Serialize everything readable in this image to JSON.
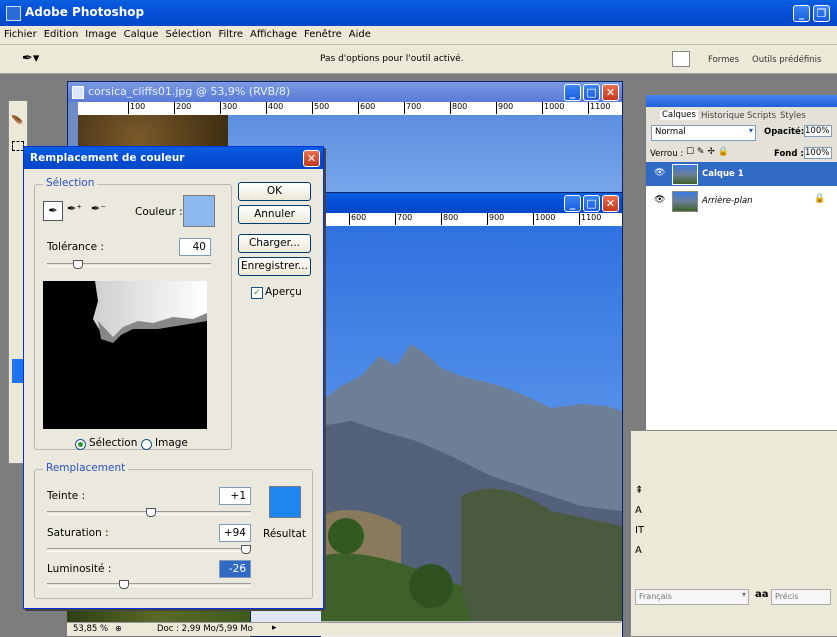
{
  "app_title": "Adobe Photoshop",
  "menu": [
    "Fichier",
    "Edition",
    "Image",
    "Calque",
    "Sélection",
    "Filtre",
    "Affichage",
    "Fenêtre",
    "Aide"
  ],
  "options_bar": {
    "message": "Pas d'options pour l'outil activé.",
    "tabs": [
      "Formes",
      "Outils prédéfinis"
    ]
  },
  "doc1": {
    "title": "corsica_cliffs01.jpg @ 53,9% (RVB/8)",
    "ruler": [
      "100",
      "200",
      "300",
      "400",
      "500",
      "600",
      "700",
      "800",
      "900",
      "1000",
      "1100"
    ]
  },
  "doc2": {
    "ruler": [
      "600",
      "700",
      "800",
      "900",
      "1000",
      "1100"
    ]
  },
  "status": {
    "zoom": "53,85 %",
    "doc": "Doc : 2,99 Mo/5,99 Mo"
  },
  "dialog": {
    "title": "Remplacement de couleur",
    "selection_group": "Sélection",
    "couleur_label": "Couleur :",
    "couleur_swatch": "#8bb9ee",
    "tolerance_label": "Tolérance :",
    "tolerance_value": "40",
    "radio_selection": "Sélection",
    "radio_image": "Image",
    "replacement_group": "Remplacement",
    "teinte_label": "Teinte :",
    "teinte_value": "+1",
    "saturation_label": "Saturation :",
    "saturation_value": "+94",
    "luminosite_label": "Luminosité :",
    "luminosite_value": "-26",
    "resultat_label": "Résultat",
    "resultat_swatch": "#1e86f0",
    "buttons": {
      "ok": "OK",
      "cancel": "Annuler",
      "load": "Charger...",
      "save": "Enregistrer..."
    },
    "preview_label": "Aperçu"
  },
  "layers_panel": {
    "tabs": [
      "Calques",
      "Historique",
      "Scripts",
      "Styles"
    ],
    "blend_mode": "Normal",
    "opacity_label": "Opacité:",
    "opacity_value": "100%",
    "lock_label": "Verrou :",
    "fill_label": "Fond :",
    "fill_value": "100%",
    "layers": [
      {
        "name": "Calque 1",
        "selected": true
      },
      {
        "name": "Arrière-plan",
        "selected": false
      }
    ]
  },
  "character_panel": {
    "language": "Français",
    "aa_label": "aa",
    "aa_mode": "Précis"
  }
}
